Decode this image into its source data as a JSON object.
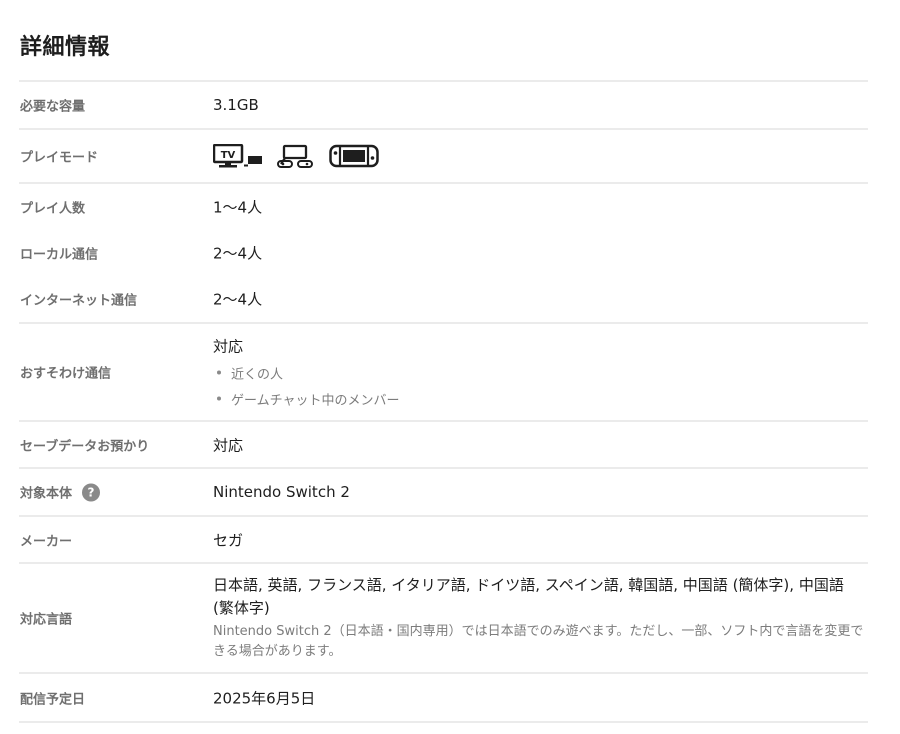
{
  "heading": "詳細情報",
  "rows": {
    "capacity": {
      "label": "必要な容量",
      "value": "3.1GB"
    },
    "play_mode": {
      "label": "プレイモード",
      "modes": [
        {
          "icon": "tv-mode-icon",
          "tv_text": "TV"
        },
        {
          "icon": "tabletop-mode-icon"
        },
        {
          "icon": "handheld-mode-icon"
        }
      ]
    },
    "players": {
      "label": "プレイ人数",
      "value": "1〜4人"
    },
    "local": {
      "label": "ローカル通信",
      "value": "2〜4人"
    },
    "internet": {
      "label": "インターネット通信",
      "value": "2〜4人"
    },
    "share": {
      "label": "おすそわけ通信",
      "value": "対応",
      "bullets": [
        "近くの人",
        "ゲームチャット中のメンバー"
      ]
    },
    "save": {
      "label": "セーブデータお預かり",
      "value": "対応"
    },
    "system": {
      "label": "対象本体",
      "help": "?",
      "value": "Nintendo Switch 2"
    },
    "maker": {
      "label": "メーカー",
      "value": "セガ"
    },
    "languages": {
      "label": "対応言語",
      "value": "日本語, 英語, フランス語, イタリア語, ドイツ語, スペイン語, 韓国語, 中国語 (簡体字), 中国語 (繁体字)",
      "note": "Nintendo Switch 2（日本語・国内専用）では日本語でのみ遊べます。ただし、一部、ソフト内で言語を変更できる場合があります。"
    },
    "release": {
      "label": "配信予定日",
      "value": "2025年6月5日"
    }
  }
}
